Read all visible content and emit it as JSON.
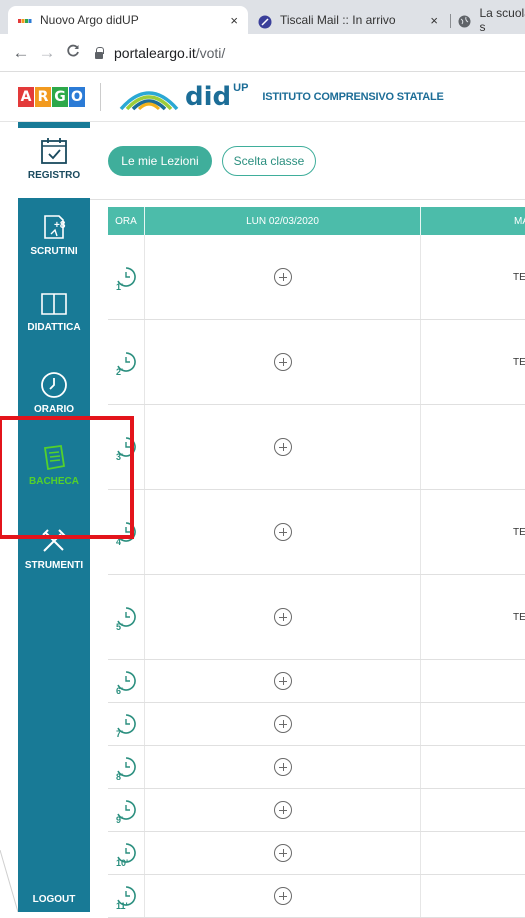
{
  "browser": {
    "tabs": [
      {
        "title": "Nuovo Argo didUP",
        "active": true
      },
      {
        "title": "Tiscali Mail :: In arrivo",
        "active": false
      },
      {
        "title": "La scuola s",
        "active": false
      }
    ],
    "close_glyph": "×",
    "url_host": "portaleargo.it",
    "url_path": "/voti/"
  },
  "header": {
    "argo_letters": [
      "A",
      "R",
      "G",
      "O"
    ],
    "argo_colors": [
      "#e33a3a",
      "#f29a1f",
      "#2da84a",
      "#2b7bd6"
    ],
    "didup_word": "did",
    "didup_sup": "UP",
    "school": "ISTITUTO COMPRENSIVO STATALE"
  },
  "sidebar": {
    "items": [
      {
        "label": "REGISTRO",
        "icon": "calendar-check-icon",
        "active": true
      },
      {
        "label": "SCRUTINI",
        "icon": "scrutini-icon",
        "active": false
      },
      {
        "label": "DIDATTICA",
        "icon": "book-icon",
        "active": false
      },
      {
        "label": "ORARIO",
        "icon": "clock-icon",
        "active": false
      },
      {
        "label": "BACHECA",
        "icon": "notepad-icon",
        "active": false
      },
      {
        "label": "STRUMENTI",
        "icon": "tools-icon",
        "active": false
      }
    ],
    "logout": "LOGOUT"
  },
  "toolbar": {
    "my_lessons": "Le mie Lezioni",
    "choose_class": "Scelta classe"
  },
  "schedule": {
    "headers": {
      "ora": "ORA",
      "mon": "LUN 02/03/2020",
      "tue": "MAR"
    },
    "rows": [
      {
        "hour": "1",
        "tue": "TEC"
      },
      {
        "hour": "2",
        "tue": "TEC"
      },
      {
        "hour": "3",
        "tue": ""
      },
      {
        "hour": "4",
        "tue": "TEC"
      },
      {
        "hour": "5",
        "tue": "TEC"
      },
      {
        "hour": "6",
        "tue": ""
      },
      {
        "hour": "7",
        "tue": ""
      },
      {
        "hour": "8",
        "tue": ""
      },
      {
        "hour": "9",
        "tue": ""
      },
      {
        "hour": "10",
        "tue": ""
      },
      {
        "hour": "11",
        "tue": ""
      }
    ]
  },
  "colors": {
    "sidebar": "#187a96",
    "accent": "#3fae9b",
    "header_row": "#4cbcaa",
    "highlight": "#e3141b",
    "bacheca": "#54d12b"
  }
}
